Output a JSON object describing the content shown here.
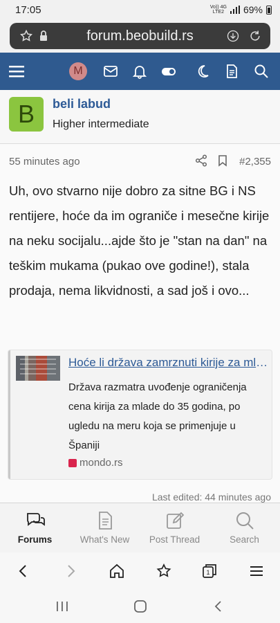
{
  "status": {
    "time": "17:05",
    "net_top": "Vo)) 4G",
    "net_bottom": "LTE2",
    "battery": "69%"
  },
  "browser": {
    "url": "forum.beobuild.rs"
  },
  "forum_nav": {
    "avatar_letter": "M"
  },
  "user": {
    "avatar_letter": "B",
    "name": "beli labud",
    "title": "Higher intermediate"
  },
  "post": {
    "time": "55 minutes ago",
    "number": "#2,355",
    "text": "Uh, ovo stvarno nije dobro za sitne BG i NS rentijere, hoće da im ograniče i mesečne kirije na neku socijalu...ajde što je \"stan na dan\" na teškim mukama (pukao ove godine!), stala prodaja, nema likvidnosti, a sad još i ovo...",
    "last_edited": "Last edited: 44 minutes ago"
  },
  "link_preview": {
    "title": "Hoće li država zamrznuti kirije za mlade",
    "description": "Država razmatra uvođenje ograničenja cena kirija za mlade do 35 godina, po ugledu na meru koja se primenjuje u Španiji",
    "source": "mondo.rs",
    "favicon_color": "#d9244d"
  },
  "tabs": [
    {
      "label": "Forums",
      "icon": "forums-icon",
      "active": true
    },
    {
      "label": "What's New",
      "icon": "document-icon",
      "active": false
    },
    {
      "label": "Post Thread",
      "icon": "compose-icon",
      "active": false
    },
    {
      "label": "Search",
      "icon": "search-icon",
      "active": false
    }
  ],
  "colors": {
    "nav_bg": "#2f5a8f",
    "link": "#2d5a96",
    "avatar_bg": "#8bc53f"
  }
}
